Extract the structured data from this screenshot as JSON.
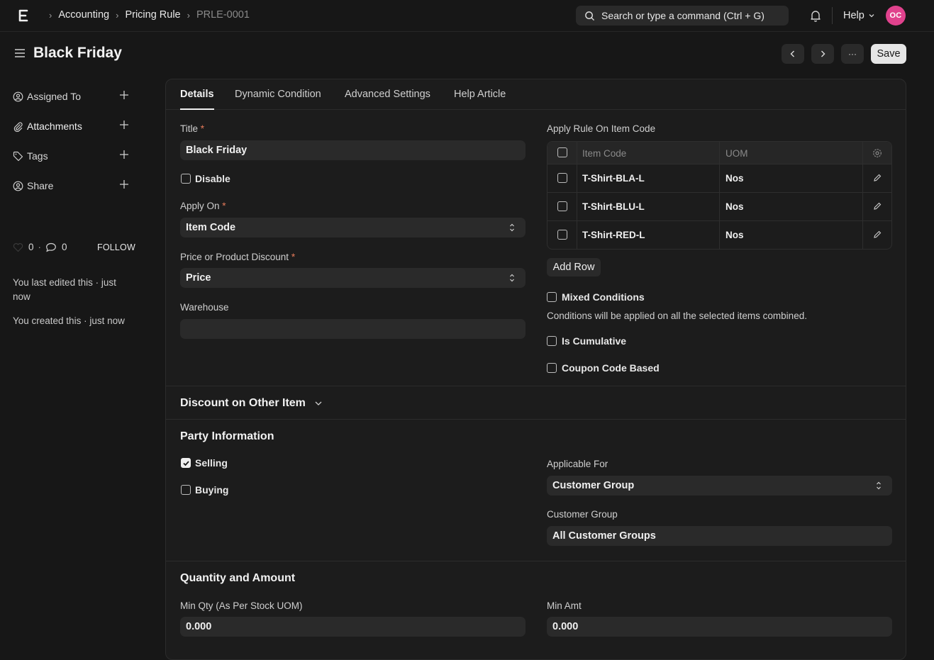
{
  "topbar": {
    "breadcrumbs": [
      "Accounting",
      "Pricing Rule",
      "PRLE-0001"
    ],
    "search_placeholder": "Search or type a command (Ctrl + G)",
    "help_label": "Help",
    "avatar_initials": "OC",
    "avatar_color": "#e0428d"
  },
  "page": {
    "title": "Black Friday",
    "save_label": "Save",
    "more_label": "···"
  },
  "sidebar": {
    "items": [
      {
        "label": "Assigned To",
        "icon": "assign-user-icon"
      },
      {
        "label": "Attachments",
        "icon": "paperclip-icon"
      },
      {
        "label": "Tags",
        "icon": "tag-icon"
      },
      {
        "label": "Share",
        "icon": "share-user-icon"
      }
    ],
    "likes": "0",
    "comments": "0",
    "follow_label": "FOLLOW",
    "last_edited": "You last edited this · just now",
    "created": "You created this · just now"
  },
  "tabs": [
    "Details",
    "Dynamic Condition",
    "Advanced Settings",
    "Help Article"
  ],
  "details": {
    "title_label": "Title",
    "title_value": "Black Friday",
    "disable_label": "Disable",
    "apply_on_label": "Apply On",
    "apply_on_value": "Item Code",
    "price_discount_label": "Price or Product Discount",
    "price_discount_value": "Price",
    "warehouse_label": "Warehouse",
    "warehouse_value": "",
    "apply_rule_label": "Apply Rule On Item Code",
    "table": {
      "headers": [
        "Item Code",
        "UOM"
      ],
      "rows": [
        {
          "item_code": "T-Shirt-BLA-L",
          "uom": "Nos"
        },
        {
          "item_code": "T-Shirt-BLU-L",
          "uom": "Nos"
        },
        {
          "item_code": "T-Shirt-RED-L",
          "uom": "Nos"
        }
      ]
    },
    "add_row_label": "Add Row",
    "mixed_conditions_label": "Mixed Conditions",
    "mixed_conditions_desc": "Conditions will be applied on all the selected items combined.",
    "is_cumulative_label": "Is Cumulative",
    "coupon_label": "Coupon Code Based"
  },
  "discount_other_item": {
    "title": "Discount on Other Item"
  },
  "party": {
    "title": "Party Information",
    "selling_label": "Selling",
    "selling_checked": true,
    "buying_label": "Buying",
    "buying_checked": false,
    "applicable_for_label": "Applicable For",
    "applicable_for_value": "Customer Group",
    "customer_group_label": "Customer Group",
    "customer_group_value": "All Customer Groups"
  },
  "quantity": {
    "title": "Quantity and Amount",
    "min_qty_label": "Min Qty (As Per Stock UOM)",
    "min_qty_value": "0.000",
    "min_amt_label": "Min Amt",
    "min_amt_value": "0.000"
  }
}
